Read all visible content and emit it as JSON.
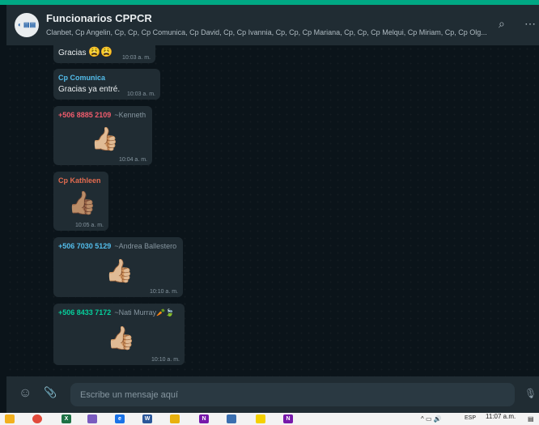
{
  "header": {
    "avatar_text": "◐ ▤▤",
    "title": "Funcionarios CPPCR",
    "members": "Clanbet, Cp Angelin, Cp, Cp, Cp Comunica, Cp David, Cp, Cp Ivannia, Cp, Cp, Cp Mariana, Cp, Cp, Cp Melqui, Cp Miriam, Cp, Cp Olg...",
    "search_icon": "⌕",
    "menu_icon": "⋯"
  },
  "messages": [
    {
      "text": "Gracias",
      "emoji": "😩😩",
      "time": "10:03 a. m."
    },
    {
      "sender": "Cp Comunica",
      "sender_color": "#53bdeb",
      "text": "Gracias ya entré.",
      "time": "10:03 a. m."
    },
    {
      "sender": "+506 8885 2109",
      "sender_color": "#f15c6d",
      "alias": "~Kenneth",
      "sticker": "👍🏼",
      "time": "10:04 a. m."
    },
    {
      "sender": "Cp Kathleen",
      "sender_color": "#e26b4f",
      "sticker": "👍🏽",
      "time": "10:05 a. m."
    },
    {
      "sender": "+506 7030 5129",
      "sender_color": "#53bdeb",
      "alias": "~Andrea Ballestero",
      "sticker": "👍🏼",
      "time": "10:10 a. m."
    },
    {
      "sender": "+506 8433 7172",
      "sender_color": "#06cf9c",
      "alias": "~Nati Murray",
      "alias_emoji": "🥕🍃",
      "sticker": "👍🏼",
      "time": "10:10 a. m."
    }
  ],
  "footer": {
    "emoji_icon": "☺",
    "attach_icon": "📎",
    "placeholder": "Escribe un mensaje aquí",
    "mic_icon": "🎙"
  },
  "taskbar": {
    "apps": [
      {
        "icon": "folder-icon",
        "color": "#f2b01e",
        "label": ""
      },
      {
        "icon": "chrome-icon",
        "color": "#e14a3b",
        "label": ""
      },
      {
        "icon": "excel-icon",
        "color": "#1e7145",
        "label": "X"
      },
      {
        "icon": "paint-icon",
        "color": "#7a5bbf",
        "label": ""
      },
      {
        "icon": "edge-icon",
        "color": "#1a73e8",
        "label": "e"
      },
      {
        "icon": "word-icon",
        "color": "#2b579a",
        "label": "W"
      },
      {
        "icon": "explorer-icon",
        "color": "#e8b10e",
        "label": ""
      },
      {
        "icon": "onenote-icon",
        "color": "#7719aa",
        "label": "N"
      },
      {
        "icon": "app-icon",
        "color": "#3a6fb0",
        "label": ""
      },
      {
        "icon": "sticky-notes-icon",
        "color": "#f5d100",
        "label": ""
      },
      {
        "icon": "onenote2-icon",
        "color": "#7719aa",
        "label": "N"
      }
    ],
    "tray_icons": "^ ▭ 🔊",
    "lang": "ESP",
    "time": "11:07 a.m.",
    "notif_icon": "▤"
  }
}
